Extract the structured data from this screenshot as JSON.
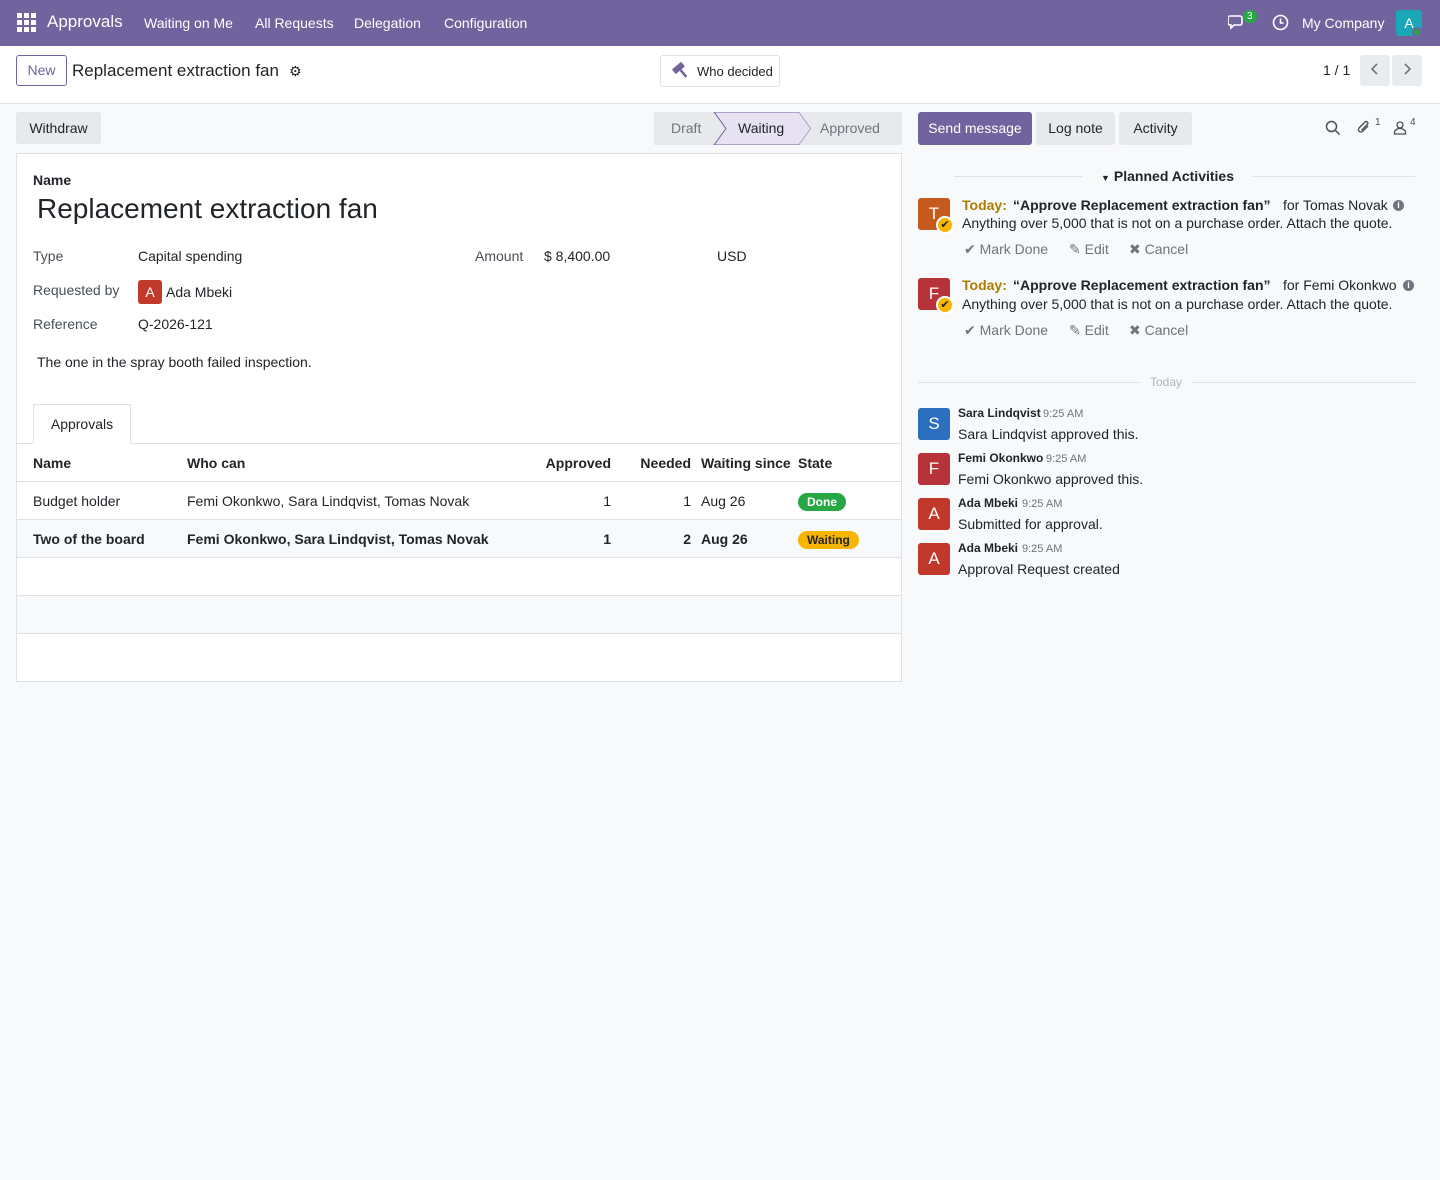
{
  "nav": {
    "app_name": "Approvals",
    "menu": [
      "Waiting on Me",
      "All Requests",
      "Delegation",
      "Configuration"
    ],
    "chat_count": "3",
    "company": "My Company",
    "user_initial": "A"
  },
  "control": {
    "new_label": "New",
    "record_title": "Replacement extraction fan",
    "who_decided_label": "Who decided",
    "pager": "1 / 1"
  },
  "form": {
    "withdraw_label": "Withdraw",
    "stages": [
      "Draft",
      "Waiting",
      "Approved"
    ],
    "active_stage": "Waiting",
    "name_label": "Name",
    "name_value": "Replacement extraction fan",
    "type_label": "Type",
    "type_value": "Capital spending",
    "amount_label": "Amount",
    "amount_value": "$ 8,400.00",
    "currency": "USD",
    "requested_by_label": "Requested by",
    "requested_by_initial": "A",
    "requested_by_value": "Ada Mbeki",
    "reference_label": "Reference",
    "reference_value": "Q-2026-121",
    "description": "The one in the spray booth failed inspection.",
    "tab_label": "Approvals",
    "table": {
      "headers": [
        "Name",
        "Who can",
        "Approved",
        "Needed",
        "Waiting since",
        "State"
      ],
      "rows": [
        {
          "name": "Budget holder",
          "who": "Femi Okonkwo, Sara Lindqvist, Tomas Novak",
          "approved": "1",
          "needed": "1",
          "since": "Aug 26",
          "state": "Done"
        },
        {
          "name": "Two of the board",
          "who": "Femi Okonkwo, Sara Lindqvist, Tomas Novak",
          "approved": "1",
          "needed": "2",
          "since": "Aug 26",
          "state": "Waiting"
        }
      ]
    }
  },
  "chatter": {
    "send_message": "Send message",
    "log_note": "Log note",
    "activity": "Activity",
    "attachments_count": "1",
    "followers_count": "4",
    "planned_title": "Planned Activities",
    "activities": [
      {
        "initial": "T",
        "color": "#c65a1e",
        "today": "Today:",
        "title": "“Approve Replacement extraction fan”",
        "for": "for Tomas Novak",
        "note": "Anything over 5,000 that is not on a purchase order. Attach the quote.",
        "mark_done": "Mark Done",
        "edit": "Edit",
        "cancel": "Cancel"
      },
      {
        "initial": "F",
        "color": "#b8323a",
        "today": "Today:",
        "title": "“Approve Replacement extraction fan”",
        "for": "for Femi Okonkwo",
        "note": "Anything over 5,000 that is not on a purchase order. Attach the quote.",
        "mark_done": "Mark Done",
        "edit": "Edit",
        "cancel": "Cancel"
      }
    ],
    "separator": "Today",
    "messages": [
      {
        "initial": "S",
        "color": "#2d6fbf",
        "author": "Sara Lindqvist",
        "time": "9:25 AM",
        "body": "Sara Lindqvist approved this."
      },
      {
        "initial": "F",
        "color": "#b8323a",
        "author": "Femi Okonkwo",
        "time": "9:25 AM",
        "body": "Femi Okonkwo approved this."
      },
      {
        "initial": "A",
        "color": "#c0392b",
        "author": "Ada Mbeki",
        "time": "9:25 AM",
        "body": "Submitted for approval."
      },
      {
        "initial": "A",
        "color": "#c0392b",
        "author": "Ada Mbeki",
        "time": "9:25 AM",
        "body": "Approval Request created"
      }
    ]
  }
}
